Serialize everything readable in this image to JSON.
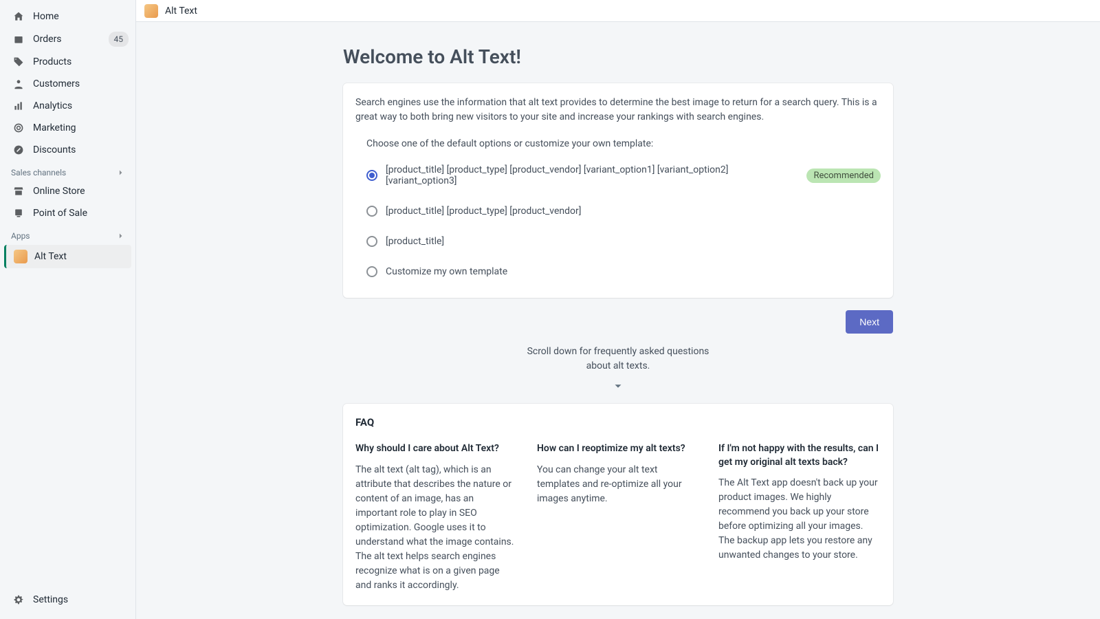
{
  "sidebar": {
    "items": [
      {
        "label": "Home"
      },
      {
        "label": "Orders",
        "badge": "45"
      },
      {
        "label": "Products"
      },
      {
        "label": "Customers"
      },
      {
        "label": "Analytics"
      },
      {
        "label": "Marketing"
      },
      {
        "label": "Discounts"
      }
    ],
    "section_sales": "Sales channels",
    "sales_items": [
      {
        "label": "Online Store"
      },
      {
        "label": "Point of Sale"
      }
    ],
    "section_apps": "Apps",
    "apps": [
      {
        "label": "Alt Text"
      }
    ],
    "settings_label": "Settings"
  },
  "topbar": {
    "title": "Alt Text"
  },
  "page": {
    "title": "Welcome to Alt Text!",
    "intro": "Search engines use the information that alt text provides to determine the best image to return for a search query. This is a great way to both bring new visitors to your site and increase your rankings with search engines.",
    "choose_label": "Choose one of the default options or customize your own template:",
    "options": [
      {
        "label": "[product_title] [product_type] [product_vendor] [variant_option1] [variant_option2] [variant_option3]",
        "recommended": true,
        "selected": true
      },
      {
        "label": "[product_title] [product_type] [product_vendor]"
      },
      {
        "label": "[product_title]"
      },
      {
        "label": "Customize my own template"
      }
    ],
    "recommended_badge": "Recommended",
    "next_label": "Next",
    "scroll_hint": "Scroll down for frequently asked questions about alt texts.",
    "faq_heading": "FAQ",
    "faq": [
      {
        "q": "Why should I care about Alt Text?",
        "a": "The alt text (alt tag), which is an attribute that describes the nature or content of an image, has an important role to play in SEO optimization. Google uses it to understand what the image contains. The alt text helps search engines recognize what is on a given page and ranks it accordingly."
      },
      {
        "q": "How can I reoptimize my alt texts?",
        "a": "You can change your alt text templates and re-optimize all your images anytime."
      },
      {
        "q": "If I'm not happy with the results, can I get my original alt texts back?",
        "a": "The Alt Text app doesn't back up your product images. We highly recommend you back up your store before optimizing all your images. The backup app lets you restore any unwanted changes to your store."
      }
    ]
  }
}
